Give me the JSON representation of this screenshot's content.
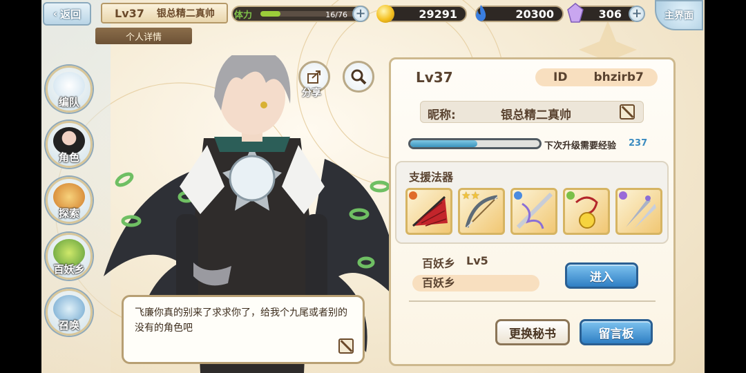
{
  "topbar": {
    "back_label": "返回",
    "level": "Lv37",
    "player_name": "银总精二真帅",
    "subtitle": "个人详情",
    "stamina_label": "体力",
    "stamina_value": "16/76",
    "stamina_fraction": 0.21,
    "gold": "29291",
    "spirit": "20300",
    "crystal": "306",
    "home_label": "主界面",
    "colors": {
      "gold": "#f4c020",
      "spirit": "#3a7ee0",
      "crystal": "#b48ce8"
    }
  },
  "sidebar": {
    "items": [
      {
        "label": "编队",
        "icon": "formation-icon"
      },
      {
        "label": "角色",
        "icon": "character-icon"
      },
      {
        "label": "探索",
        "icon": "explore-icon"
      },
      {
        "label": "百妖乡",
        "icon": "village-icon"
      },
      {
        "label": "召唤",
        "icon": "summon-icon"
      }
    ]
  },
  "tools": {
    "share_label": "分享"
  },
  "speech": {
    "text": "飞廉你真的别来了求求你了，给我个九尾或者别的没有的角色吧"
  },
  "profile": {
    "level": "Lv37",
    "id_label": "ID",
    "id_value": "bhzirb7",
    "nickname_label": "昵称:",
    "nickname_value": "银总精二真帅",
    "exp_text": "下次升级需要经验",
    "exp_value": "237",
    "exp_fraction": 0.52
  },
  "support": {
    "title": "支援法器",
    "items": [
      {
        "name": "red-fan",
        "stars": 0,
        "element_color": "#e06b2a"
      },
      {
        "name": "silver-bow",
        "stars": 2,
        "element_color": "#7ac048"
      },
      {
        "name": "spirit-blade",
        "stars": 0,
        "element_color": "#4a8be0"
      },
      {
        "name": "golden-bell",
        "stars": 0,
        "element_color": "#7ac048"
      },
      {
        "name": "twin-daggers",
        "stars": 0,
        "element_color": "#9a6ad8"
      }
    ]
  },
  "village": {
    "title": "百妖乡",
    "level": "Lv5",
    "name": "百妖乡",
    "enter_label": "进入"
  },
  "buttons": {
    "change_secretary": "更换秘书",
    "message_board": "留言板"
  }
}
